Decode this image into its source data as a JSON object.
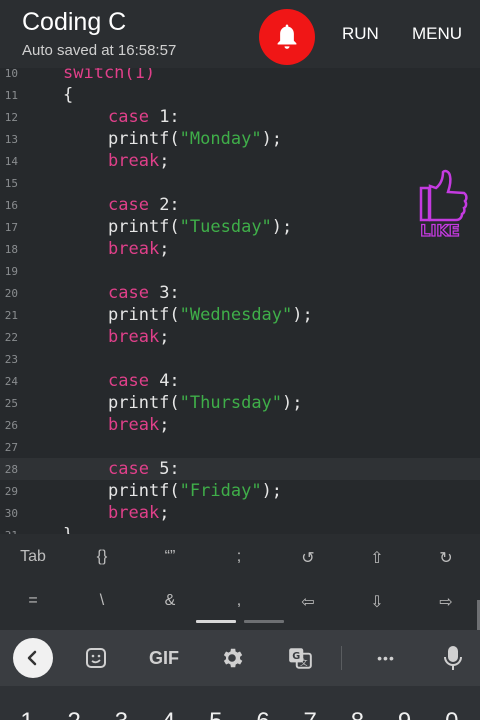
{
  "header": {
    "title": "Coding C",
    "subtitle": "Auto saved at 16:58:57",
    "run_label": "RUN",
    "menu_label": "MENU",
    "bell_color": "#f01616"
  },
  "editor": {
    "lines": [
      {
        "n": "10",
        "parts": [
          {
            "t": "switch(1)",
            "c": "kw"
          }
        ],
        "indent": 0
      },
      {
        "n": "11",
        "parts": [
          {
            "t": "{",
            "c": "pun"
          }
        ],
        "indent": 0
      },
      {
        "n": "12",
        "parts": [
          {
            "t": "case",
            "c": "kw"
          },
          {
            "t": " 1:",
            "c": "pun"
          }
        ],
        "indent": 1
      },
      {
        "n": "13",
        "parts": [
          {
            "t": "printf",
            "c": "fn"
          },
          {
            "t": "(",
            "c": "pun"
          },
          {
            "t": "\"Monday\"",
            "c": "str"
          },
          {
            "t": ");",
            "c": "pun"
          }
        ],
        "indent": 1
      },
      {
        "n": "14",
        "parts": [
          {
            "t": "break",
            "c": "kw"
          },
          {
            "t": ";",
            "c": "pun"
          }
        ],
        "indent": 1
      },
      {
        "n": "15",
        "parts": [],
        "indent": 0
      },
      {
        "n": "16",
        "parts": [
          {
            "t": "case",
            "c": "kw"
          },
          {
            "t": " 2:",
            "c": "pun"
          }
        ],
        "indent": 1
      },
      {
        "n": "17",
        "parts": [
          {
            "t": "printf",
            "c": "fn"
          },
          {
            "t": "(",
            "c": "pun"
          },
          {
            "t": "\"Tuesday\"",
            "c": "str"
          },
          {
            "t": ");",
            "c": "pun"
          }
        ],
        "indent": 1
      },
      {
        "n": "18",
        "parts": [
          {
            "t": "break",
            "c": "kw"
          },
          {
            "t": ";",
            "c": "pun"
          }
        ],
        "indent": 1
      },
      {
        "n": "19",
        "parts": [],
        "indent": 0
      },
      {
        "n": "20",
        "parts": [
          {
            "t": "case",
            "c": "kw"
          },
          {
            "t": " 3:",
            "c": "pun"
          }
        ],
        "indent": 1
      },
      {
        "n": "21",
        "parts": [
          {
            "t": "printf",
            "c": "fn"
          },
          {
            "t": "(",
            "c": "pun"
          },
          {
            "t": "\"Wednesday\"",
            "c": "str"
          },
          {
            "t": ");",
            "c": "pun"
          }
        ],
        "indent": 1
      },
      {
        "n": "22",
        "parts": [
          {
            "t": "break",
            "c": "kw"
          },
          {
            "t": ";",
            "c": "pun"
          }
        ],
        "indent": 1
      },
      {
        "n": "23",
        "parts": [],
        "indent": 0
      },
      {
        "n": "24",
        "parts": [
          {
            "t": "case",
            "c": "kw"
          },
          {
            "t": " 4:",
            "c": "pun"
          }
        ],
        "indent": 1
      },
      {
        "n": "25",
        "parts": [
          {
            "t": "printf",
            "c": "fn"
          },
          {
            "t": "(",
            "c": "pun"
          },
          {
            "t": "\"Thursday\"",
            "c": "str"
          },
          {
            "t": ");",
            "c": "pun"
          }
        ],
        "indent": 1
      },
      {
        "n": "26",
        "parts": [
          {
            "t": "break",
            "c": "kw"
          },
          {
            "t": ";",
            "c": "pun"
          }
        ],
        "indent": 1
      },
      {
        "n": "27",
        "parts": [],
        "indent": 0
      },
      {
        "n": "28",
        "parts": [
          {
            "t": "case",
            "c": "kw"
          },
          {
            "t": " 5:",
            "c": "pun"
          }
        ],
        "indent": 1,
        "current": true
      },
      {
        "n": "29",
        "parts": [
          {
            "t": "printf",
            "c": "fn"
          },
          {
            "t": "(",
            "c": "pun"
          },
          {
            "t": "\"Friday\"",
            "c": "str"
          },
          {
            "t": ");",
            "c": "pun"
          }
        ],
        "indent": 1
      },
      {
        "n": "30",
        "parts": [
          {
            "t": "break",
            "c": "kw"
          },
          {
            "t": ";",
            "c": "pun"
          }
        ],
        "indent": 1
      },
      {
        "n": "31",
        "parts": [
          {
            "t": "}",
            "c": "pun"
          }
        ],
        "indent": 0
      }
    ],
    "like_label": "LIKE",
    "like_color": "#c43be0"
  },
  "symbols": {
    "row1": [
      "Tab",
      "{}",
      "“”",
      ";",
      "↺",
      "⇧",
      "↻"
    ],
    "row2": [
      "=",
      "\\",
      "&",
      ",",
      "⇦",
      "⇩",
      "⇨"
    ]
  },
  "keyboard": {
    "toolbar_icons": [
      "back-icon",
      "sticker-icon",
      "gif-icon",
      "settings-icon",
      "translate-icon",
      "more-icon",
      "mic-icon"
    ],
    "gif_label": "GIF",
    "more_label": "•••",
    "number_row": [
      "1",
      "2",
      "3",
      "4",
      "5",
      "6",
      "7",
      "8",
      "9",
      "0"
    ]
  }
}
